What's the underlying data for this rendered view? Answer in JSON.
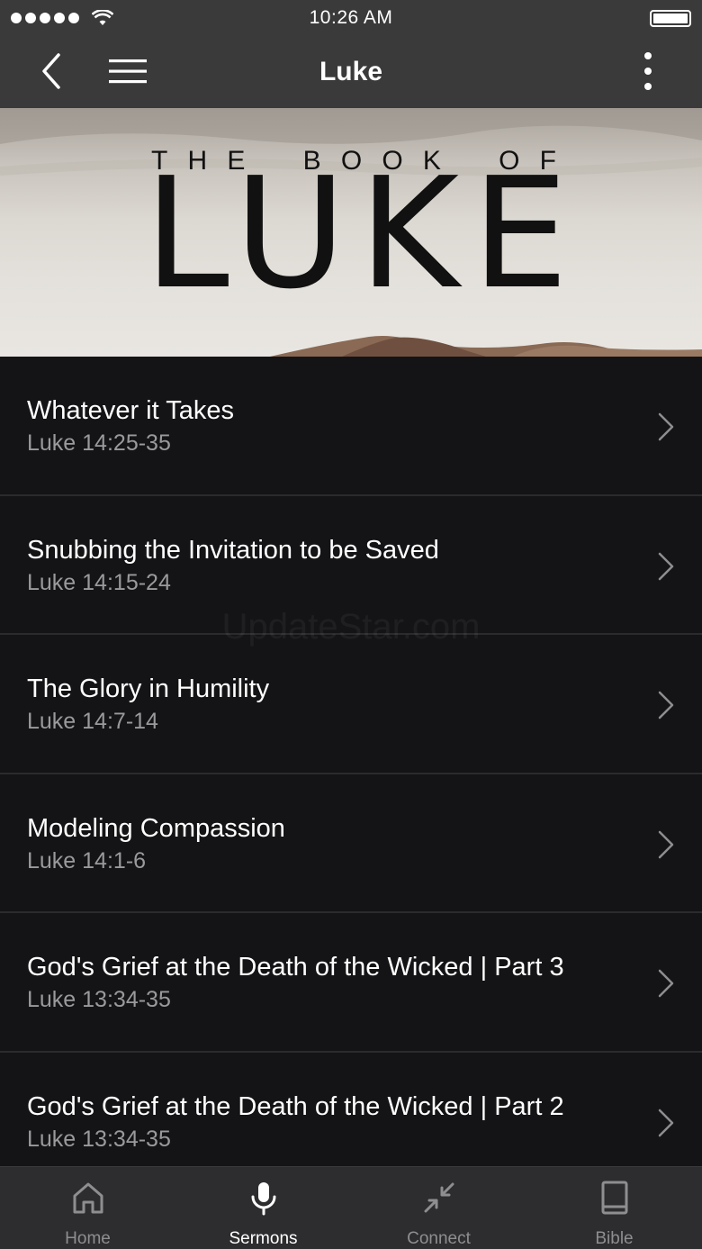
{
  "status_bar": {
    "time": "10:26 AM"
  },
  "nav": {
    "title": "Luke",
    "back_icon": "chevron-left-icon",
    "menu_icon": "hamburger-icon",
    "more_icon": "vertical-dots-icon"
  },
  "banner": {
    "subtitle_letters": [
      "T",
      "H",
      "E",
      "B",
      "O",
      "O",
      "K",
      "O",
      "F"
    ],
    "title": "LUKE"
  },
  "sermons": [
    {
      "title": "Whatever it Takes",
      "passage": "Luke 14:25-35"
    },
    {
      "title": "Snubbing the Invitation to be Saved",
      "passage": "Luke 14:15-24"
    },
    {
      "title": "The Glory in Humility",
      "passage": "Luke 14:7-14"
    },
    {
      "title": "Modeling Compassion",
      "passage": "Luke 14:1-6"
    },
    {
      "title": "God's Grief at the Death of the Wicked | Part 3",
      "passage": "Luke 13:34-35"
    },
    {
      "title": "God's Grief at the Death of the Wicked | Part 2",
      "passage": "Luke 13:34-35"
    }
  ],
  "watermark": "UpdateStar.com",
  "tabs": [
    {
      "label": "Home",
      "icon": "home-icon",
      "active": false
    },
    {
      "label": "Sermons",
      "icon": "microphone-icon",
      "active": true
    },
    {
      "label": "Connect",
      "icon": "connect-arrows-icon",
      "active": false
    },
    {
      "label": "Bible",
      "icon": "book-icon",
      "active": false
    }
  ],
  "colors": {
    "bar_bg": "#3a3a3a",
    "list_bg": "#141416",
    "tab_bg": "#2d2d2f",
    "inactive": "#8e8e90",
    "active": "#ffffff"
  }
}
